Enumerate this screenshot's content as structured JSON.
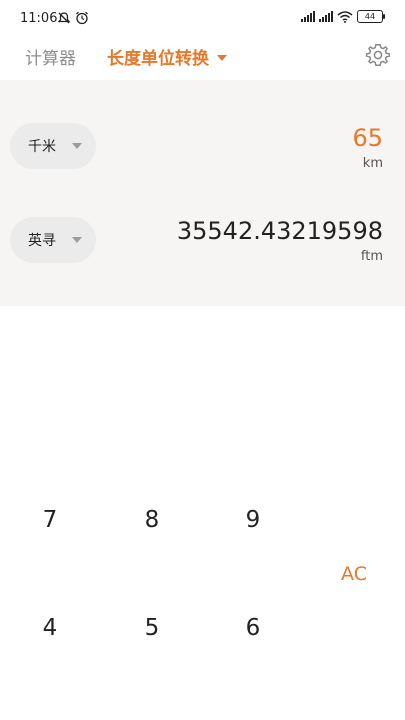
{
  "status_bar": {
    "time": "11:06",
    "battery": "44"
  },
  "tabs": {
    "calculator": "计算器",
    "length_converter": "长度单位转换"
  },
  "converter": {
    "from": {
      "unit_name": "千米",
      "value": "65",
      "unit_symbol": "km"
    },
    "to": {
      "unit_name": "英寻",
      "value": "35542.43219598",
      "unit_symbol": "ftm"
    }
  },
  "keypad": {
    "k7": "7",
    "k8": "8",
    "k9": "9",
    "k4": "4",
    "k5": "5",
    "k6": "6",
    "ac": "AC"
  },
  "colors": {
    "accent": "#e6782a",
    "panel_background": "#f6f5f3",
    "pill_background": "#ebebeb"
  }
}
